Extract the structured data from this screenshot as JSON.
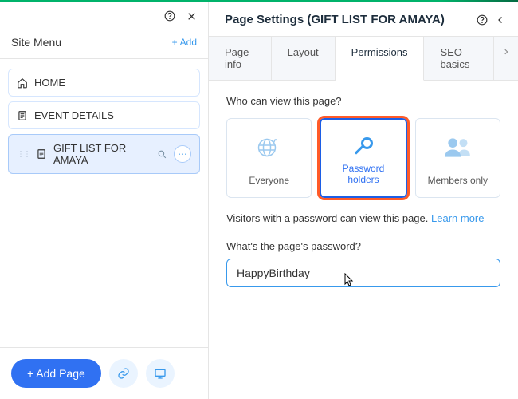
{
  "left": {
    "site_menu_label": "Site Menu",
    "add_label": "Add",
    "items": [
      {
        "label": "HOME",
        "icon": "home-icon"
      },
      {
        "label": "EVENT DETAILS",
        "icon": "document-icon"
      },
      {
        "label": "GIFT LIST FOR AMAYA",
        "icon": "document-icon"
      }
    ],
    "add_page_label": "+ Add Page"
  },
  "right": {
    "title": "Page Settings (GIFT LIST FOR AMAYA)",
    "tabs": [
      {
        "label": "Page info"
      },
      {
        "label": "Layout"
      },
      {
        "label": "Permissions",
        "active": true
      },
      {
        "label": "SEO basics"
      }
    ],
    "view_question": "Who can view this page?",
    "cards": [
      {
        "label": "Everyone",
        "icon": "globe-icon"
      },
      {
        "label": "Password holders",
        "icon": "key-icon",
        "selected": true
      },
      {
        "label": "Members only",
        "icon": "members-icon"
      }
    ],
    "description": "Visitors with a password can view this page.",
    "learn_more": "Learn more",
    "password_label": "What's the page's password?",
    "password_value": "HappyBirthday"
  },
  "colors": {
    "accent": "#3899ec",
    "primary": "#3071f2",
    "highlight": "#ff5a28",
    "icon_light": "#9bc9ef"
  }
}
